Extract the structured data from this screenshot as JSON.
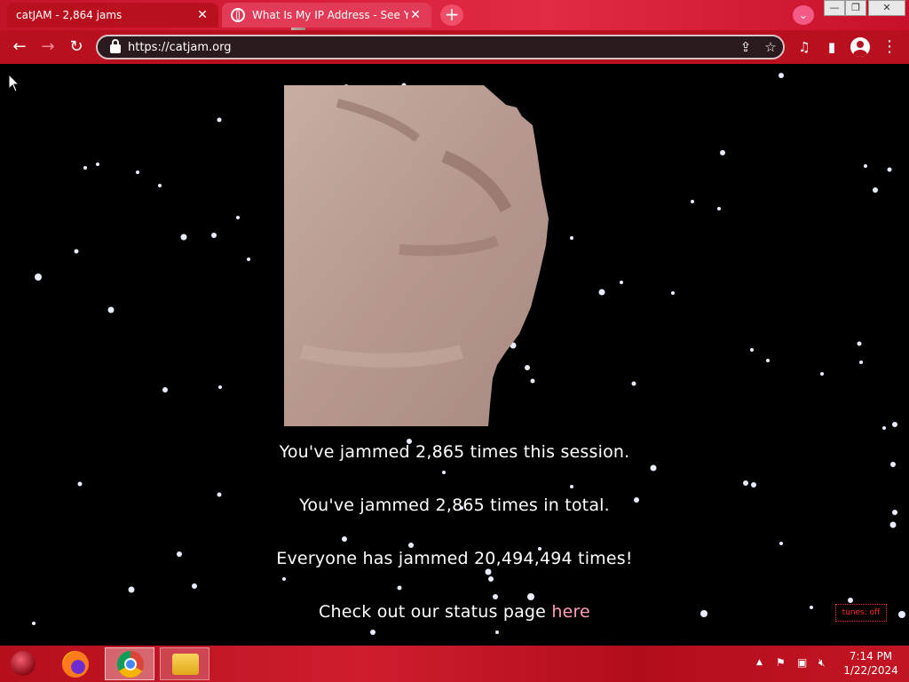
{
  "browser": {
    "tabs": [
      {
        "title": "catJAM - 2,864 jams",
        "active": true
      },
      {
        "title": "What Is My IP Address - See Your",
        "active": false
      }
    ],
    "new_tab_label": "+",
    "url": "https://catjam.org"
  },
  "page": {
    "line_session": "You've jammed 2,865 times this session.",
    "line_total": "You've jammed 2,865 times in total.",
    "line_everyone": "Everyone has jammed 20,494,494 times!",
    "status_prefix": "Check out our status page",
    "status_link": "here",
    "tunes_toggle": "tunes: off"
  },
  "taskbar": {
    "apps": [
      "start-orb",
      "firefox",
      "chrome",
      "file-explorer"
    ],
    "time": "7:14 PM",
    "date": "1/22/2024"
  },
  "colors": {
    "chrome_red": "#b8101f",
    "page_bg": "#000000",
    "link_pink": "#ff9fb3",
    "tunes_red": "#ff2a2a"
  }
}
